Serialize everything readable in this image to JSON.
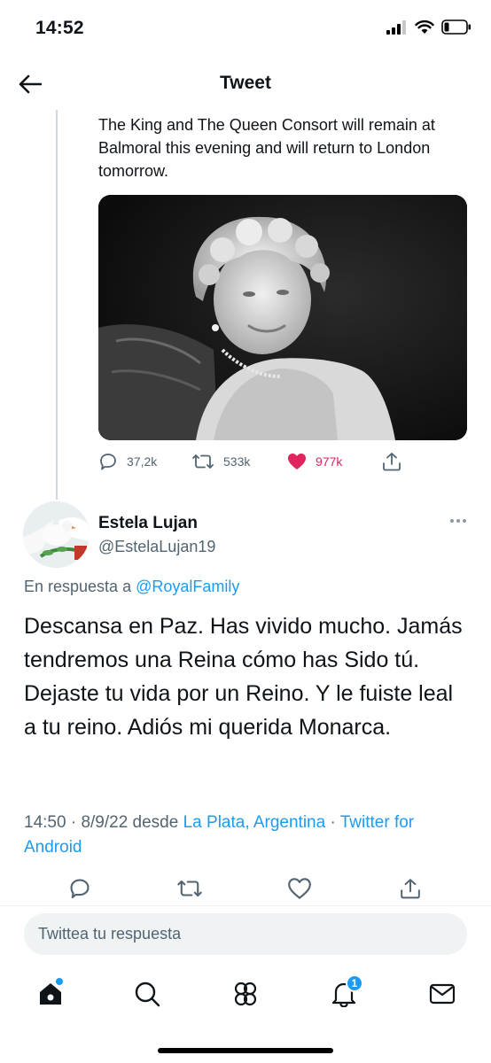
{
  "status_bar": {
    "time": "14:52"
  },
  "header": {
    "title": "Tweet"
  },
  "parent_tweet": {
    "text": "The King and The Queen Consort will remain at Balmoral this evening and will return to London tomorrow.",
    "replies": "37,2k",
    "retweets": "533k",
    "likes": "977k"
  },
  "reply_tweet": {
    "name": "Estela Lujan",
    "handle": "@EstelaLujan19",
    "reply_prefix": "En respuesta a",
    "reply_to": "@RoyalFamily",
    "text": "Descansa en Paz. Has vivido mucho. Jamás tendremos una Reina cómo has Sido tú. Dejaste tu vida por un Reino. Y le fuiste leal a tu reino. Adiós mi querida Monarca.",
    "time": "14:50",
    "date": "8/9/22",
    "location_prefix": "desde",
    "location": "La Plata, Argentina",
    "source": "Twitter for Android"
  },
  "reply_box": {
    "placeholder": "Twittea tu respuesta"
  },
  "bottom_nav": {
    "notifications_badge": "1"
  },
  "colors": {
    "accent": "#1d9bf0",
    "like": "#e0245e",
    "muted": "#536471"
  }
}
